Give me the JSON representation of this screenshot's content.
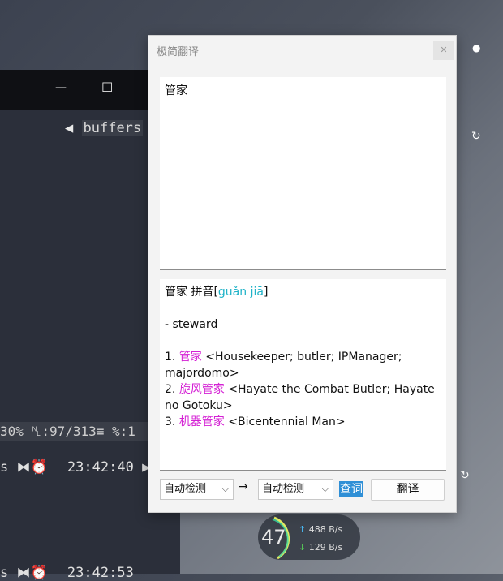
{
  "terminal": {
    "minimize_glyph": "—",
    "maximize_glyph": "☐",
    "buffers_label": "buffers",
    "status_text": "30% ␤:97/313≡ %:1",
    "time_line_1": "23:42:40",
    "time_line_2": "23:42:53",
    "s_char_1": "s",
    "s_char_2": "s"
  },
  "window": {
    "title": "极简翻译",
    "close_glyph": "✕",
    "input_text": "管家",
    "output": {
      "headword": "管家",
      "pinyin_label": "拼音",
      "pinyin_open": "[",
      "pinyin": "guǎn jiā",
      "pinyin_close": "]",
      "meaning": "- steward",
      "entries": [
        {
          "num": "1.",
          "term": "管家",
          "gloss": "<Housekeeper; butler; IPManager; majordomo>"
        },
        {
          "num": "2.",
          "term": "旋风管家",
          "gloss": "<Hayate the Combat Butler; Hayate no Gotoku>"
        },
        {
          "num": "3.",
          "term": "机器管家",
          "gloss": "<Bicentennial Man>"
        }
      ]
    },
    "source_lang": "自动检测",
    "target_lang": "自动检测",
    "arrow": "→",
    "query_label": "查词",
    "translate_label": "翻译"
  },
  "network": {
    "percent": "47",
    "upload": "488 B/s",
    "download": "129 B/s",
    "up_arrow": "↑",
    "down_arrow": "↓"
  }
}
